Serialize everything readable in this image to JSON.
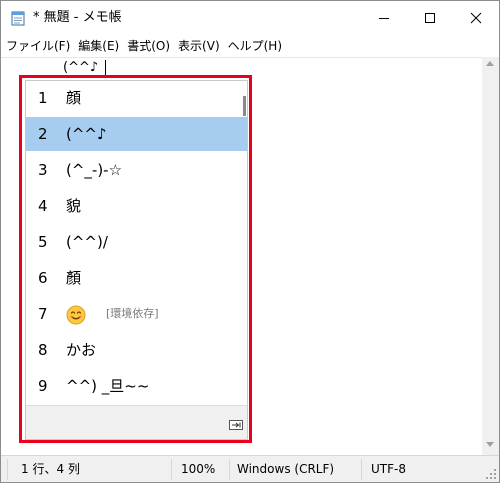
{
  "window": {
    "title": "* 無題 - メモ帳"
  },
  "menu": [
    {
      "label": "ファイル(F)"
    },
    {
      "label": "編集(E)"
    },
    {
      "label": "書式(O)"
    },
    {
      "label": "表示(V)"
    },
    {
      "label": "ヘルプ(H)"
    }
  ],
  "editor": {
    "composition": "(^^♪"
  },
  "candidates": [
    {
      "num": "1",
      "text": "顔",
      "note": ""
    },
    {
      "num": "2",
      "text": "(^^♪",
      "note": "",
      "selected": true
    },
    {
      "num": "3",
      "text": "(^_-)-☆",
      "note": ""
    },
    {
      "num": "4",
      "text": "貌",
      "note": ""
    },
    {
      "num": "5",
      "text": "(^^)/",
      "note": ""
    },
    {
      "num": "6",
      "text": "顏",
      "note": ""
    },
    {
      "num": "7",
      "text": "😊",
      "note": "[環境依存]"
    },
    {
      "num": "8",
      "text": "かお",
      "note": ""
    },
    {
      "num": "9",
      "text": "^^) _旦~~",
      "note": ""
    }
  ],
  "status": {
    "position": "1 行、4 列",
    "zoom": "100%",
    "line_ending": "Windows (CRLF)",
    "encoding": "UTF-8"
  },
  "colors": {
    "selected_candidate": "#a6cdf0",
    "highlight_frame": "#e8001c",
    "status_bar": "#f0f0f0"
  }
}
